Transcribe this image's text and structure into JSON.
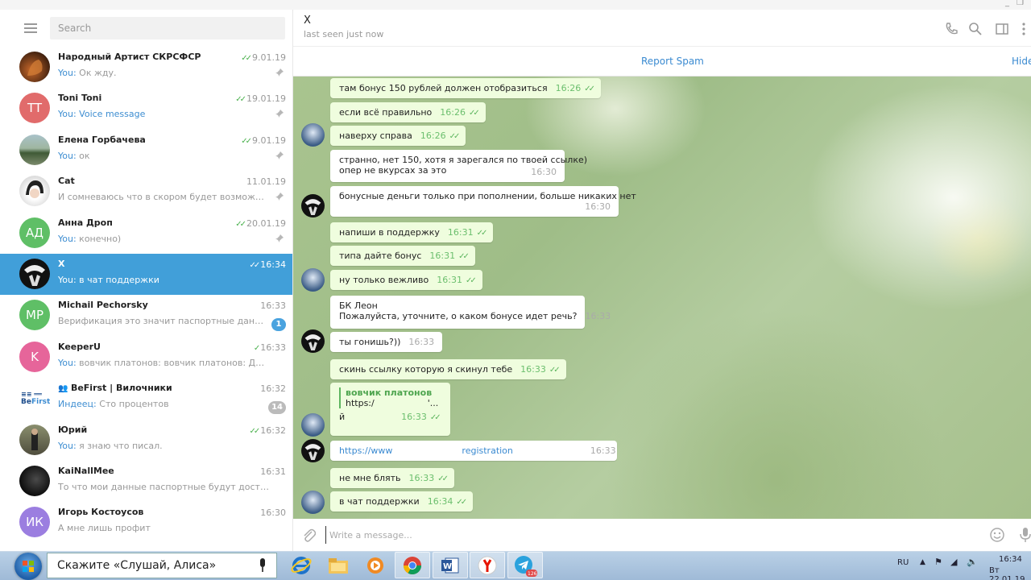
{
  "search": {
    "placeholder": "Search"
  },
  "chats": [
    {
      "name": "Народный Артист СКРСФСР",
      "you": "You:",
      "preview": " Ок жду.",
      "time": "9.01.19",
      "read": true,
      "pinned": true,
      "avatar_type": "photo",
      "avatar_color": "#6b3a1e"
    },
    {
      "name": "Toni Toni",
      "you": "You:",
      "preview": " Voice message",
      "preview_highlight": true,
      "time": "19.01.19",
      "read": true,
      "pinned": true,
      "initials": "TT",
      "avatar_color": "#e16b6b"
    },
    {
      "name": "Елена Горбачева",
      "you": "You:",
      "preview": " ок",
      "time": "9.01.19",
      "read": true,
      "pinned": true,
      "avatar_type": "photo",
      "avatar_color": "#5e7d6e"
    },
    {
      "name": "Cat",
      "you": "",
      "preview": "И сомневаюсь что в скором будет возможность",
      "time": "11.01.19",
      "read": false,
      "pinned": true,
      "avatar_type": "photo",
      "avatar_color": "#ddd"
    },
    {
      "name": "Анна Дроп",
      "you": "You:",
      "preview": " конечно)",
      "time": "20.01.19",
      "read": true,
      "pinned": true,
      "initials": "АД",
      "avatar_color": "#5fbf66"
    },
    {
      "name": "X",
      "you": "You:",
      "preview": " в чат поддержки",
      "time": "16:34",
      "read": true,
      "active": true,
      "avatar_type": "photo",
      "avatar_color": "#111"
    },
    {
      "name": "Michail Pechorsky",
      "you": "",
      "preview": "Верификация это значит паспортные данные до...",
      "time": "16:33",
      "read": false,
      "unread": "1",
      "initials": "MP",
      "avatar_color": "#5fbf66"
    },
    {
      "name": "KeeperU",
      "you": "You:",
      "preview": " вовчик платонов: вовчик платонов: Даю ссылку...",
      "time": "16:33",
      "read": true,
      "single": true,
      "initials": "K",
      "avatar_color": "#e6659a"
    },
    {
      "name": "BeFirst | Вилочники",
      "you": "Индеец:",
      "preview": " Сто процентов",
      "time": "16:32",
      "read": false,
      "unread": "14",
      "muted": true,
      "group": true,
      "avatar_type": "logo",
      "avatar_color": "#fff"
    },
    {
      "name": "Юрий",
      "you": "You:",
      "preview": " я знаю что писал.",
      "time": "16:32",
      "read": true,
      "avatar_type": "photo",
      "avatar_color": "#6d6d55"
    },
    {
      "name": "KaiNallMee",
      "you": "",
      "preview": "То что мои данные паспортные будут доступны",
      "time": "16:31",
      "read": false,
      "avatar_type": "photo",
      "avatar_color": "#1a1a1a"
    },
    {
      "name": "Игорь Костоусов",
      "you": "",
      "preview": "А мне лишь профит",
      "time": "16:30",
      "read": false,
      "initials": "ИК",
      "avatar_color": "#9b7ee0"
    }
  ],
  "header": {
    "peer_name": "X",
    "peer_status": "last seen just now"
  },
  "spam_bar": {
    "report": "Report Spam",
    "hide": "Hide"
  },
  "messages": [
    {
      "dir": "out",
      "text": "там бонус 150 рублей должен отобразиться",
      "time": "16:26"
    },
    {
      "dir": "out",
      "text": "если всё правильно",
      "time": "16:26"
    },
    {
      "dir": "out",
      "text": "наверху справа",
      "time": "16:26"
    },
    {
      "dir": "in",
      "line1": "странно, нет 150, хотя я зарегался по твоей ссылке)",
      "line2": "опер не вкурсах за это",
      "time": "16:30"
    },
    {
      "dir": "in",
      "text": "бонусные деньги только при пополнении, больше никаких нет",
      "time": "16:30"
    },
    {
      "dir": "out",
      "text": "напиши в поддержку",
      "time": "16:31"
    },
    {
      "dir": "out",
      "text": "типа дайте бонус",
      "time": "16:31"
    },
    {
      "dir": "out",
      "text": "ну только вежливо",
      "time": "16:31"
    },
    {
      "dir": "in",
      "line1": "БК Леон",
      "line2": "Пожалуйста, уточните, о каком бонусе идет речь?",
      "time": "16:33"
    },
    {
      "dir": "in",
      "text": "ты гонишь?))",
      "time": "16:33"
    },
    {
      "dir": "out",
      "text": "скинь ссылку которую я скинул тебе",
      "time": "16:33"
    },
    {
      "dir": "out",
      "quote_name": "вовчик платонов",
      "quote_text": "https:/",
      "quote_tail": "'...",
      "text": "й",
      "time": "16:33"
    },
    {
      "dir": "in",
      "link_start": "https://www",
      "link_end": "registration",
      "time": "16:33"
    },
    {
      "dir": "out",
      "text": "не мне блять",
      "time": "16:33"
    },
    {
      "dir": "out",
      "text": "в чат поддержки",
      "time": "16:34"
    }
  ],
  "composer": {
    "placeholder": "Write a message..."
  },
  "taskbar": {
    "alice": "Скажите «Слушай, Алиса»",
    "lang": "RU",
    "time": "16:34",
    "date": "Вт 22.01.19",
    "telegram_badge": "126"
  }
}
